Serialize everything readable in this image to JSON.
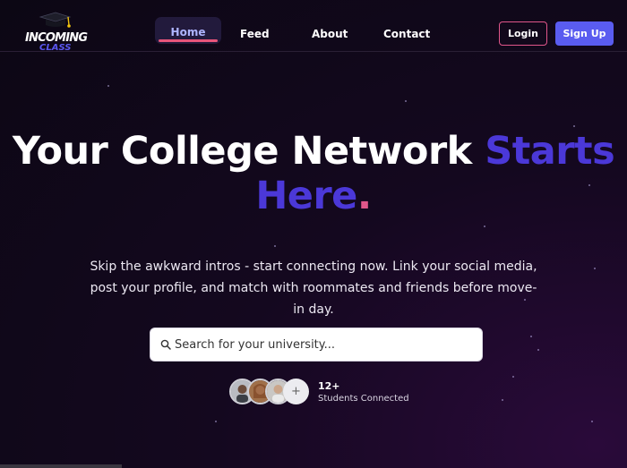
{
  "brand": {
    "line1": "INCOMING",
    "line2": "CLASS",
    "icon": "graduation-cap-icon"
  },
  "nav": {
    "items": [
      {
        "label": "Home",
        "active": true
      },
      {
        "label": "Feed"
      },
      {
        "label": "About"
      },
      {
        "label": "Contact"
      }
    ],
    "login_label": "Login",
    "signup_label": "Sign Up"
  },
  "hero": {
    "title_main": "Your College Network",
    "title_accent": "Starts Here",
    "title_dot": ".",
    "subtitle": "Skip the awkward intros - start connecting now. Link your social media, post your profile, and match with roommates and friends before move-in day."
  },
  "search": {
    "placeholder": "Search for your university..."
  },
  "social_proof": {
    "count": "12+",
    "label": "Students Connected",
    "more_symbol": "+"
  },
  "colors": {
    "accent": "#4b38d8",
    "brand_blue": "#5a5cf0",
    "pink": "#e0568a",
    "background": "#0c0714"
  }
}
